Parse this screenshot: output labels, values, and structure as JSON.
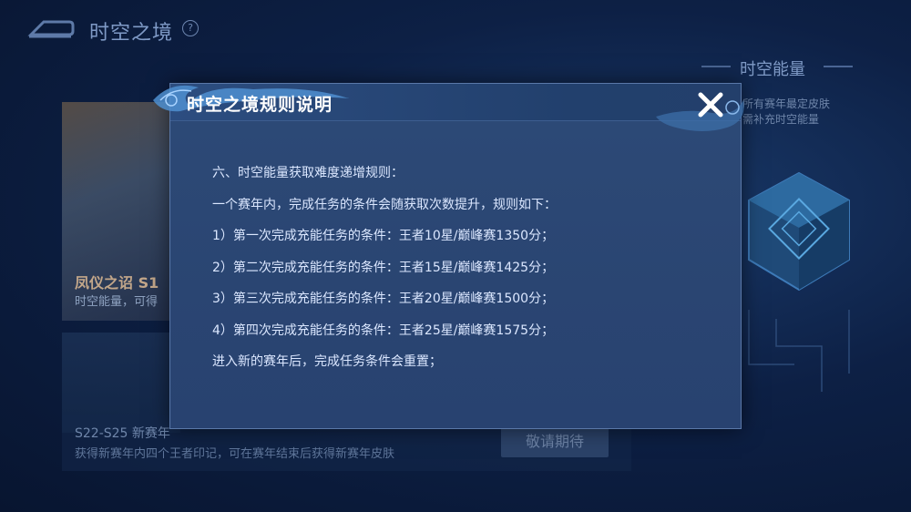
{
  "header": {
    "title": "时空之境",
    "help_glyph": "?"
  },
  "background": {
    "card1_title": "凤仪之诏 S1",
    "card1_sub": "时空能量，可得",
    "season_title": "S22-S25 新赛年",
    "season_desc": "获得新赛年内四个王者印记，可在赛年结束后获得新赛年皮肤",
    "stay_tuned_label": "敬请期待",
    "energy_title": "时空能量",
    "energy_desc_1": "所有赛年最定皮肤",
    "energy_desc_2": "需补充时空能量"
  },
  "dialog": {
    "title": "时空之境规则说明",
    "close_glyph": "✕",
    "lines": [
      "六、时空能量获取难度递增规则：",
      "一个赛年内，完成任务的条件会随获取次数提升，规则如下：",
      "1）第一次完成充能任务的条件：王者10星/巅峰赛1350分；",
      "2）第二次完成充能任务的条件：王者15星/巅峰赛1425分；",
      "3）第三次完成充能任务的条件：王者20星/巅峰赛1500分；",
      "4）第四次完成充能任务的条件：王者25星/巅峰赛1575分；",
      "进入新的赛年后，完成任务条件会重置；"
    ]
  },
  "colors": {
    "dialog_bg": "#2a4572",
    "title_text": "#ffffff",
    "body_text": "#dbe7ff",
    "page_bg": "#0d2045"
  },
  "icons": {
    "back": "back-arrow-icon",
    "help": "help-icon",
    "close": "close-icon"
  }
}
